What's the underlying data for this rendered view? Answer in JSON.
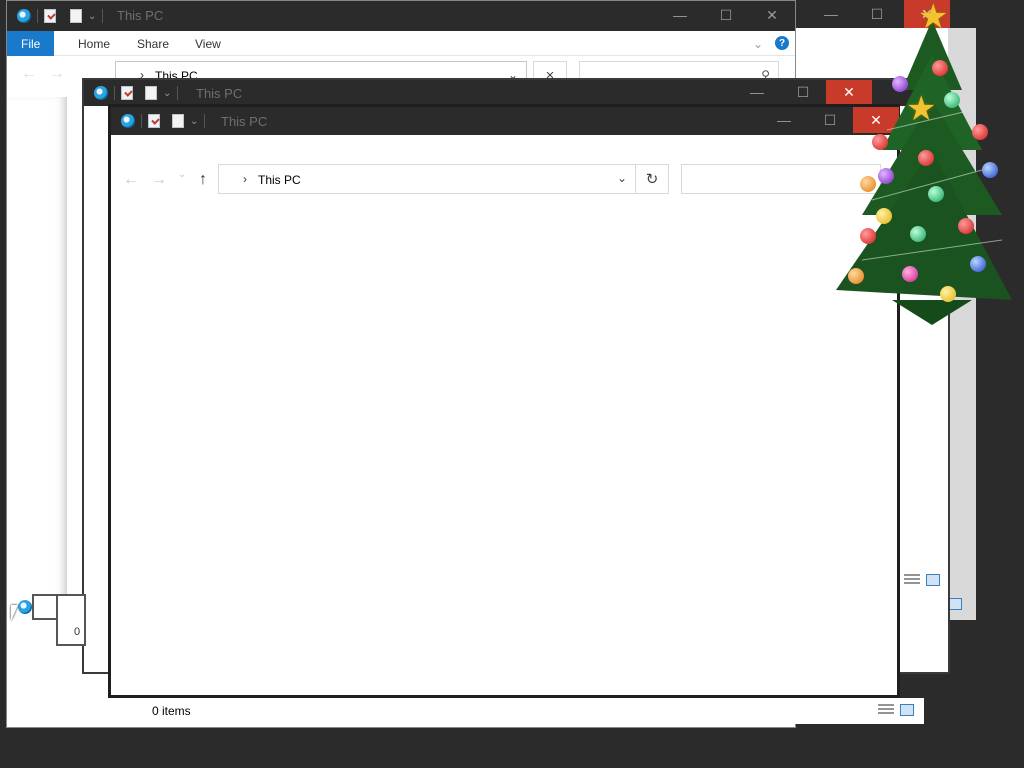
{
  "windows": [
    {
      "id": "back",
      "title": "This PC",
      "ribbon_tabs": [
        "File",
        "Home",
        "Share",
        "View"
      ],
      "address": "This PC",
      "status": ""
    },
    {
      "id": "middle",
      "title": "This PC",
      "status_count_partial": "0"
    },
    {
      "id": "front",
      "title": "This PC",
      "address": "This PC",
      "status": "0 items"
    }
  ],
  "caption_buttons": {
    "minimize": "—",
    "maximize": "☐",
    "close": "✕"
  },
  "icons": {
    "app": "this-pc-icon",
    "properties": "properties-icon",
    "new_folder": "new-folder-icon",
    "customize": "customize-quick-access-icon",
    "back": "back-arrow-icon",
    "forward": "forward-arrow-icon",
    "recent": "recent-locations-icon",
    "up": "up-arrow-icon",
    "refresh": "refresh-icon",
    "search": "search-icon",
    "help": "help-icon",
    "details_view": "details-view-icon",
    "large_icons_view": "large-icons-view-icon",
    "tree": "christmas-tree-decoration",
    "cursor": "mouse-pointer-icon"
  },
  "glyphs": {
    "back": "←",
    "forward": "→",
    "recent": "⌄",
    "up": "↑",
    "crumb_sep": "›",
    "dropdown": "⌄",
    "refresh": "↻",
    "close_x": "×",
    "help": "?",
    "search": "⚲",
    "star": "★"
  },
  "colors": {
    "titlebar": "#2b2b2b",
    "close": "#c83a2a",
    "file_tab": "#1979ca",
    "desktop": "#2b2b2b"
  }
}
